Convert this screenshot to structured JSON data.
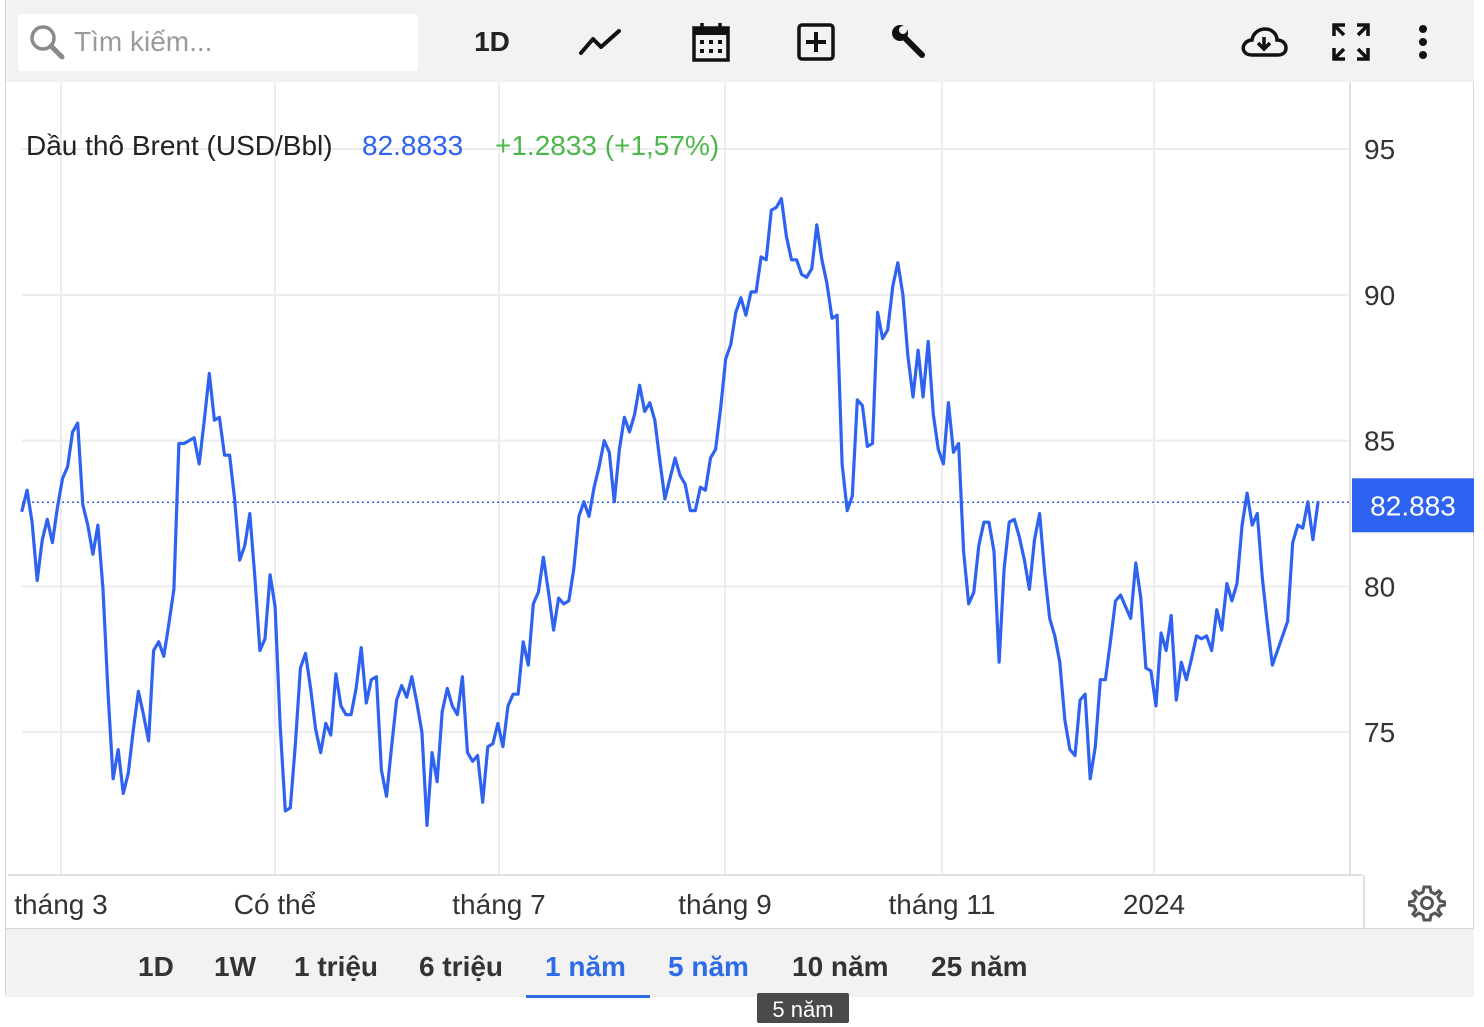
{
  "toolbar": {
    "search_placeholder": "Tìm kiếm...",
    "interval": "1D"
  },
  "icons": {
    "search": "search-icon",
    "chart_type": "line-chart-icon",
    "calendar": "calendar-icon",
    "compare": "add-square-icon",
    "indicators": "wrench-icon",
    "download": "cloud-download-icon",
    "fullscreen": "fullscreen-icon",
    "more": "more-vertical-icon",
    "settings": "gear-icon"
  },
  "header": {
    "name": "Dầu thô Brent (USD/Bbl)",
    "price": "82.8833",
    "change": "+1.2833 (+1,57%)"
  },
  "colors": {
    "line": "#2e62f0",
    "change_up": "#4cb84c",
    "price_text": "#2e62f0",
    "price_tag_bg": "#2e62f0",
    "active_range": "#2e6be6"
  },
  "price_tag": "82.883",
  "ranges": [
    "1D",
    "1W",
    "1 triệu",
    "6 triệu",
    "1 năm",
    "5 năm",
    "10 năm",
    "25 năm"
  ],
  "active_range": "1 năm",
  "tooltip": "5 năm",
  "chart_data": {
    "type": "line",
    "title": "",
    "xlabel": "",
    "ylabel": "",
    "x_ticks": [
      "tháng 3",
      "Có thể",
      "tháng 7",
      "tháng 9",
      "tháng 11",
      "2024"
    ],
    "y_ticks": [
      75,
      80,
      85,
      90,
      95
    ],
    "ylim": [
      70.1,
      97.3
    ],
    "last_value": 82.8833,
    "grid": true,
    "series": [
      {
        "values": [
          82.6,
          83.3,
          82.2,
          80.2,
          81.6,
          82.3,
          81.5,
          82.7,
          83.7,
          84.1,
          85.3,
          85.6,
          82.8,
          82.1,
          81.1,
          82.1,
          79.9,
          76.3,
          73.4,
          74.4,
          72.9,
          73.6,
          75.1,
          76.4,
          75.6,
          74.7,
          77.8,
          78.1,
          77.6,
          78.7,
          79.9,
          84.9,
          84.9,
          85.0,
          85.1,
          84.2,
          85.7,
          87.3,
          85.7,
          85.8,
          84.5,
          84.5,
          83.0,
          80.9,
          81.4,
          82.5,
          80.3,
          77.8,
          78.2,
          80.4,
          79.3,
          75.2,
          72.3,
          72.4,
          74.6,
          77.2,
          77.7,
          76.5,
          75.1,
          74.3,
          75.3,
          74.9,
          77.0,
          75.9,
          75.6,
          75.6,
          76.5,
          77.9,
          76.0,
          76.8,
          76.9,
          73.7,
          72.8,
          74.5,
          76.1,
          76.6,
          76.2,
          76.9,
          76.0,
          75.0,
          71.8,
          74.3,
          73.3,
          75.7,
          76.5,
          75.9,
          75.6,
          76.9,
          74.3,
          74.0,
          74.2,
          72.6,
          74.5,
          74.6,
          75.3,
          74.5,
          75.9,
          76.3,
          76.3,
          78.1,
          77.3,
          79.4,
          79.8,
          81.0,
          79.8,
          78.5,
          79.6,
          79.4,
          79.5,
          80.6,
          82.4,
          82.9,
          82.4,
          83.4,
          84.1,
          85.0,
          84.6,
          82.9,
          84.7,
          85.8,
          85.3,
          85.9,
          86.9,
          86.0,
          86.3,
          85.7,
          84.3,
          83.0,
          83.7,
          84.4,
          83.8,
          83.5,
          82.6,
          82.6,
          83.4,
          83.3,
          84.4,
          84.7,
          86.1,
          87.8,
          88.3,
          89.4,
          89.9,
          89.3,
          90.1,
          90.1,
          91.3,
          91.2,
          92.9,
          93.0,
          93.3,
          92.0,
          91.2,
          91.2,
          90.7,
          90.6,
          90.9,
          92.4,
          91.2,
          90.4,
          89.2,
          89.3,
          84.2,
          82.6,
          83.1,
          86.4,
          86.2,
          84.8,
          84.9,
          89.4,
          88.5,
          88.8,
          90.3,
          91.1,
          90.0,
          87.9,
          86.5,
          88.1,
          86.5,
          88.4,
          85.9,
          84.7,
          84.2,
          86.3,
          84.6,
          84.9,
          81.2,
          79.4,
          79.8,
          81.4,
          82.2,
          82.2,
          81.2,
          77.4,
          80.6,
          82.2,
          82.3,
          81.7,
          80.9,
          79.9,
          81.6,
          82.5,
          80.5,
          78.9,
          78.3,
          77.4,
          75.4,
          74.4,
          74.2,
          76.1,
          76.3,
          73.4,
          74.5,
          76.8,
          76.8,
          78.1,
          79.5,
          79.7,
          79.3,
          78.9,
          80.8,
          79.6,
          77.2,
          77.1,
          75.9,
          78.4,
          77.8,
          79.0,
          76.1,
          77.4,
          76.8,
          77.5,
          78.3,
          78.2,
          78.3,
          77.8,
          79.2,
          78.5,
          80.1,
          79.5,
          80.1,
          82.1,
          83.2,
          82.1,
          82.5,
          80.3,
          78.7,
          77.3,
          77.8,
          78.3,
          78.8,
          81.5,
          82.1,
          82.0,
          82.9,
          81.6,
          82.88
        ]
      }
    ]
  }
}
